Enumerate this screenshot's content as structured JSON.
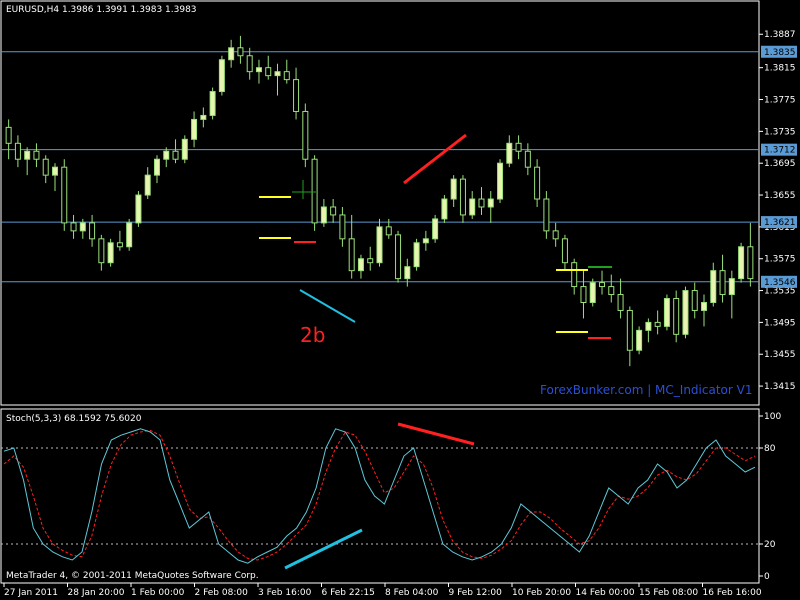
{
  "main": {
    "title": "EURUSD,H4  1.3986 1.3991 1.3983 1.3983",
    "price_axis": [
      {
        "value": 1.3857,
        "label": "1.3887"
      },
      {
        "value": 1.3815,
        "label": "1.3815"
      },
      {
        "value": 1.3775,
        "label": "1.3775"
      },
      {
        "value": 1.3735,
        "label": "1.3735"
      },
      {
        "value": 1.3695,
        "label": "1.3695"
      },
      {
        "value": 1.3655,
        "label": "1.3655"
      },
      {
        "value": 1.3615,
        "label": "1.3615"
      },
      {
        "value": 1.3575,
        "label": "1.3575"
      },
      {
        "value": 1.3535,
        "label": "1.3535"
      },
      {
        "value": 1.3495,
        "label": "1.3495"
      },
      {
        "value": 1.3455,
        "label": "1.3455"
      },
      {
        "value": 1.3415,
        "label": "1.3415"
      }
    ],
    "hlines": [
      {
        "value": 1.3835,
        "label": "1.3835"
      },
      {
        "value": 1.3712,
        "label": "1.3712"
      },
      {
        "value": 1.3621,
        "label": "1.3621"
      },
      {
        "value": 1.3546,
        "label": "1.3546"
      }
    ],
    "annotation": "2b",
    "watermark": "ForexBunker.com | MC_Indicator V1"
  },
  "stoch": {
    "title": "Stoch(5,3,3) 68.1592 75.6020",
    "levels": [
      {
        "value": 100,
        "label": "100"
      },
      {
        "value": 80,
        "label": "80"
      },
      {
        "value": 20,
        "label": "20"
      },
      {
        "value": 0,
        "label": "0"
      }
    ]
  },
  "footer": {
    "copyright": "MetaTrader 4, © 2001-2011 MetaQuotes Software Corp."
  },
  "time_axis": [
    "27 Jan 2011",
    "28 Jan 20:00",
    "1 Feb 00:00",
    "2 Feb 08:00",
    "3 Feb 16:00",
    "6 Feb 22:15",
    "8 Feb 04:00",
    "9 Feb 12:00",
    "10 Feb 20:00",
    "14 Feb 00:00",
    "15 Feb 08:00",
    "16 Feb 16:00"
  ],
  "colors": {
    "background": "#000000",
    "bull_candle": "#e8f5b0",
    "bear_candle": "#000000",
    "wick": "#9be07a",
    "hline": "#5b9bd5",
    "stoch_main": "#5fc8d8",
    "stoch_signal": "#ff2020",
    "trend_red": "#ff2020",
    "trend_cyan": "#20c0e0",
    "marker_yellow": "#ffff20",
    "marker_green": "#20a020",
    "marker_red": "#ff2020"
  },
  "chart_data": {
    "type": "candlestick",
    "main_ylim": [
      1.3395,
      1.3895
    ],
    "stoch_ylim": [
      0,
      100
    ],
    "candles": [
      [
        1.374,
        1.375,
        1.37,
        1.372
      ],
      [
        1.372,
        1.373,
        1.369,
        1.37
      ],
      [
        1.37,
        1.3715,
        1.368,
        1.371
      ],
      [
        1.371,
        1.372,
        1.369,
        1.37
      ],
      [
        1.37,
        1.3705,
        1.367,
        1.368
      ],
      [
        1.368,
        1.3695,
        1.366,
        1.369
      ],
      [
        1.369,
        1.37,
        1.361,
        1.362
      ],
      [
        1.362,
        1.363,
        1.36,
        1.361
      ],
      [
        1.361,
        1.3625,
        1.36,
        1.362
      ],
      [
        1.362,
        1.363,
        1.359,
        1.36
      ],
      [
        1.36,
        1.3605,
        1.356,
        1.357
      ],
      [
        1.357,
        1.36,
        1.3565,
        1.3595
      ],
      [
        1.3595,
        1.361,
        1.3585,
        1.359
      ],
      [
        1.359,
        1.3625,
        1.3585,
        1.362
      ],
      [
        1.362,
        1.366,
        1.3615,
        1.3655
      ],
      [
        1.3655,
        1.369,
        1.365,
        1.368
      ],
      [
        1.368,
        1.3705,
        1.367,
        1.37
      ],
      [
        1.37,
        1.3715,
        1.369,
        1.371
      ],
      [
        1.371,
        1.3725,
        1.3695,
        1.37
      ],
      [
        1.37,
        1.373,
        1.3695,
        1.3725
      ],
      [
        1.3725,
        1.376,
        1.3715,
        1.375
      ],
      [
        1.375,
        1.3765,
        1.374,
        1.3755
      ],
      [
        1.3755,
        1.379,
        1.375,
        1.3785
      ],
      [
        1.3785,
        1.383,
        1.378,
        1.3825
      ],
      [
        1.3825,
        1.385,
        1.3815,
        1.384
      ],
      [
        1.384,
        1.3855,
        1.382,
        1.383
      ],
      [
        1.383,
        1.384,
        1.38,
        1.381
      ],
      [
        1.381,
        1.3825,
        1.3795,
        1.3815
      ],
      [
        1.3815,
        1.383,
        1.38,
        1.3805
      ],
      [
        1.3805,
        1.382,
        1.378,
        1.381
      ],
      [
        1.381,
        1.3825,
        1.3795,
        1.38
      ],
      [
        1.38,
        1.3815,
        1.375,
        1.376
      ],
      [
        1.376,
        1.377,
        1.369,
        1.37
      ],
      [
        1.37,
        1.3705,
        1.361,
        1.362
      ],
      [
        1.362,
        1.365,
        1.3615,
        1.364
      ],
      [
        1.364,
        1.365,
        1.362,
        1.363
      ],
      [
        1.363,
        1.364,
        1.359,
        1.36
      ],
      [
        1.36,
        1.363,
        1.355,
        1.356
      ],
      [
        1.356,
        1.358,
        1.355,
        1.3575
      ],
      [
        1.3575,
        1.359,
        1.356,
        1.357
      ],
      [
        1.357,
        1.3625,
        1.3565,
        1.3615
      ],
      [
        1.3615,
        1.3625,
        1.36,
        1.3605
      ],
      [
        1.3605,
        1.361,
        1.3545,
        1.355
      ],
      [
        1.355,
        1.3575,
        1.354,
        1.3565
      ],
      [
        1.3565,
        1.36,
        1.356,
        1.3595
      ],
      [
        1.3595,
        1.361,
        1.3585,
        1.36
      ],
      [
        1.36,
        1.363,
        1.3595,
        1.3625
      ],
      [
        1.3625,
        1.3655,
        1.362,
        1.365
      ],
      [
        1.365,
        1.368,
        1.364,
        1.3675
      ],
      [
        1.3675,
        1.368,
        1.362,
        1.363
      ],
      [
        1.363,
        1.366,
        1.3625,
        1.365
      ],
      [
        1.365,
        1.3665,
        1.363,
        1.364
      ],
      [
        1.364,
        1.366,
        1.362,
        1.365
      ],
      [
        1.365,
        1.37,
        1.3645,
        1.3695
      ],
      [
        1.3695,
        1.373,
        1.369,
        1.372
      ],
      [
        1.372,
        1.373,
        1.37,
        1.371
      ],
      [
        1.371,
        1.372,
        1.368,
        1.369
      ],
      [
        1.369,
        1.37,
        1.364,
        1.365
      ],
      [
        1.365,
        1.366,
        1.36,
        1.361
      ],
      [
        1.361,
        1.362,
        1.359,
        1.36
      ],
      [
        1.36,
        1.3605,
        1.356,
        1.357
      ],
      [
        1.357,
        1.3575,
        1.353,
        1.354
      ],
      [
        1.354,
        1.356,
        1.35,
        1.352
      ],
      [
        1.352,
        1.355,
        1.3515,
        1.3545
      ],
      [
        1.3545,
        1.356,
        1.353,
        1.354
      ],
      [
        1.354,
        1.3555,
        1.352,
        1.353
      ],
      [
        1.353,
        1.355,
        1.35,
        1.351
      ],
      [
        1.351,
        1.3515,
        1.344,
        1.346
      ],
      [
        1.346,
        1.349,
        1.3455,
        1.3485
      ],
      [
        1.3485,
        1.35,
        1.347,
        1.3495
      ],
      [
        1.3495,
        1.351,
        1.348,
        1.349
      ],
      [
        1.349,
        1.353,
        1.3485,
        1.3525
      ],
      [
        1.3525,
        1.3535,
        1.347,
        1.348
      ],
      [
        1.348,
        1.354,
        1.3475,
        1.3535
      ],
      [
        1.3535,
        1.3545,
        1.35,
        1.351
      ],
      [
        1.351,
        1.353,
        1.349,
        1.352
      ],
      [
        1.352,
        1.357,
        1.3515,
        1.356
      ],
      [
        1.356,
        1.358,
        1.352,
        1.353
      ],
      [
        1.353,
        1.356,
        1.35,
        1.355
      ],
      [
        1.355,
        1.3595,
        1.3545,
        1.359
      ],
      [
        1.359,
        1.362,
        1.354,
        1.355
      ]
    ],
    "stoch_main": [
      78,
      80,
      60,
      30,
      20,
      15,
      12,
      10,
      15,
      40,
      70,
      85,
      88,
      90,
      92,
      90,
      85,
      60,
      45,
      30,
      35,
      40,
      20,
      15,
      10,
      8,
      12,
      15,
      18,
      25,
      30,
      40,
      55,
      80,
      92,
      90,
      80,
      60,
      50,
      45,
      60,
      75,
      80,
      60,
      40,
      20,
      15,
      12,
      10,
      12,
      15,
      20,
      30,
      45,
      40,
      35,
      30,
      25,
      20,
      15,
      25,
      40,
      55,
      50,
      45,
      55,
      60,
      70,
      65,
      55,
      60,
      70,
      80,
      85,
      75,
      70,
      65,
      68
    ],
    "stoch_signal": [
      70,
      75,
      68,
      50,
      30,
      20,
      16,
      13,
      12,
      25,
      50,
      70,
      82,
      88,
      90,
      91,
      88,
      75,
      58,
      42,
      36,
      37,
      30,
      22,
      15,
      11,
      10,
      12,
      15,
      20,
      26,
      32,
      45,
      65,
      80,
      90,
      88,
      78,
      65,
      52,
      55,
      65,
      75,
      70,
      55,
      35,
      22,
      15,
      12,
      11,
      13,
      17,
      22,
      32,
      40,
      40,
      36,
      30,
      25,
      20,
      22,
      30,
      42,
      50,
      48,
      50,
      55,
      63,
      66,
      62,
      60,
      64,
      72,
      80,
      80,
      76,
      72,
      75
    ]
  }
}
